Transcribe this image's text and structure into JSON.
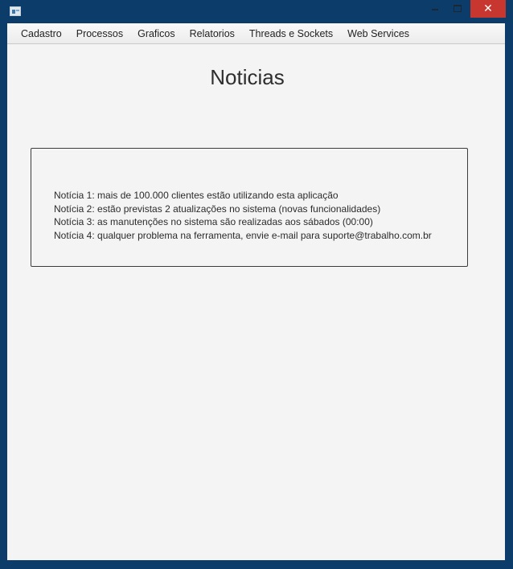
{
  "window": {
    "controls": {
      "minimize_icon": "minimize-icon",
      "maximize_icon": "maximize-icon",
      "close_glyph": "✕"
    },
    "accent_close": "#c7372f",
    "frame_color": "#0b3c6a"
  },
  "menu": {
    "items": [
      {
        "label": "Cadastro"
      },
      {
        "label": "Processos"
      },
      {
        "label": "Graficos"
      },
      {
        "label": "Relatorios"
      },
      {
        "label": "Threads e Sockets"
      },
      {
        "label": "Web Services"
      }
    ]
  },
  "page": {
    "title": "Noticias"
  },
  "news": {
    "items": [
      {
        "text": "Notícia 1: mais de 100.000 clientes estão utilizando esta aplicação"
      },
      {
        "text": "Notícia 2: estão previstas 2 atualizações no sistema (novas funcionalidades)"
      },
      {
        "text": "Notícia 3: as manutenções no sistema são realizadas aos sábados (00:00)"
      },
      {
        "text": "Notícia 4: qualquer problema na ferramenta, envie e-mail para suporte@trabalho.com.br"
      }
    ]
  }
}
